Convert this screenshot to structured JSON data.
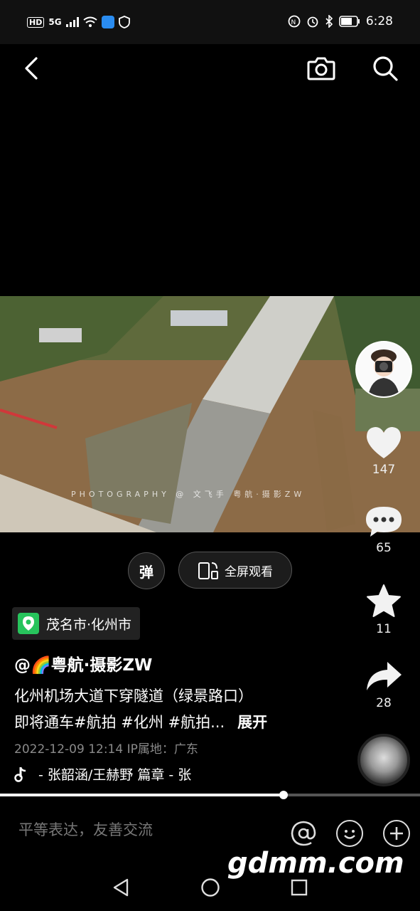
{
  "status_bar": {
    "left_badges": [
      "HD",
      "5G"
    ],
    "time": "6:28"
  },
  "video": {
    "watermark": "PHOTOGRAPHY @ 文飞手 粤航·摄影ZW",
    "progress": 0.675
  },
  "controls": {
    "danmu_label": "弹",
    "fullscreen_label": "全屏观看"
  },
  "rail": {
    "like_count": "147",
    "comment_count": "65",
    "favorite_count": "11",
    "share_count": "28"
  },
  "post": {
    "location": "茂名市·化州市",
    "author": "@🌈粤航·摄影ZW",
    "description_line1": "化州机场大道下穿隧道（绿景路口）",
    "description_line2": "即将通车#航拍 #化州 #航拍...",
    "expand_label": "展开",
    "meta": "2022-12-09 12:14  IP属地：广东",
    "music": "- 张韶涵/王赫野    篇章 - 张"
  },
  "comment_bar": {
    "placeholder": "平等表达，友善交流"
  },
  "watermark_site": "gdmm.com",
  "colors": {
    "location_green": "#27c45c",
    "background": "#000000"
  }
}
